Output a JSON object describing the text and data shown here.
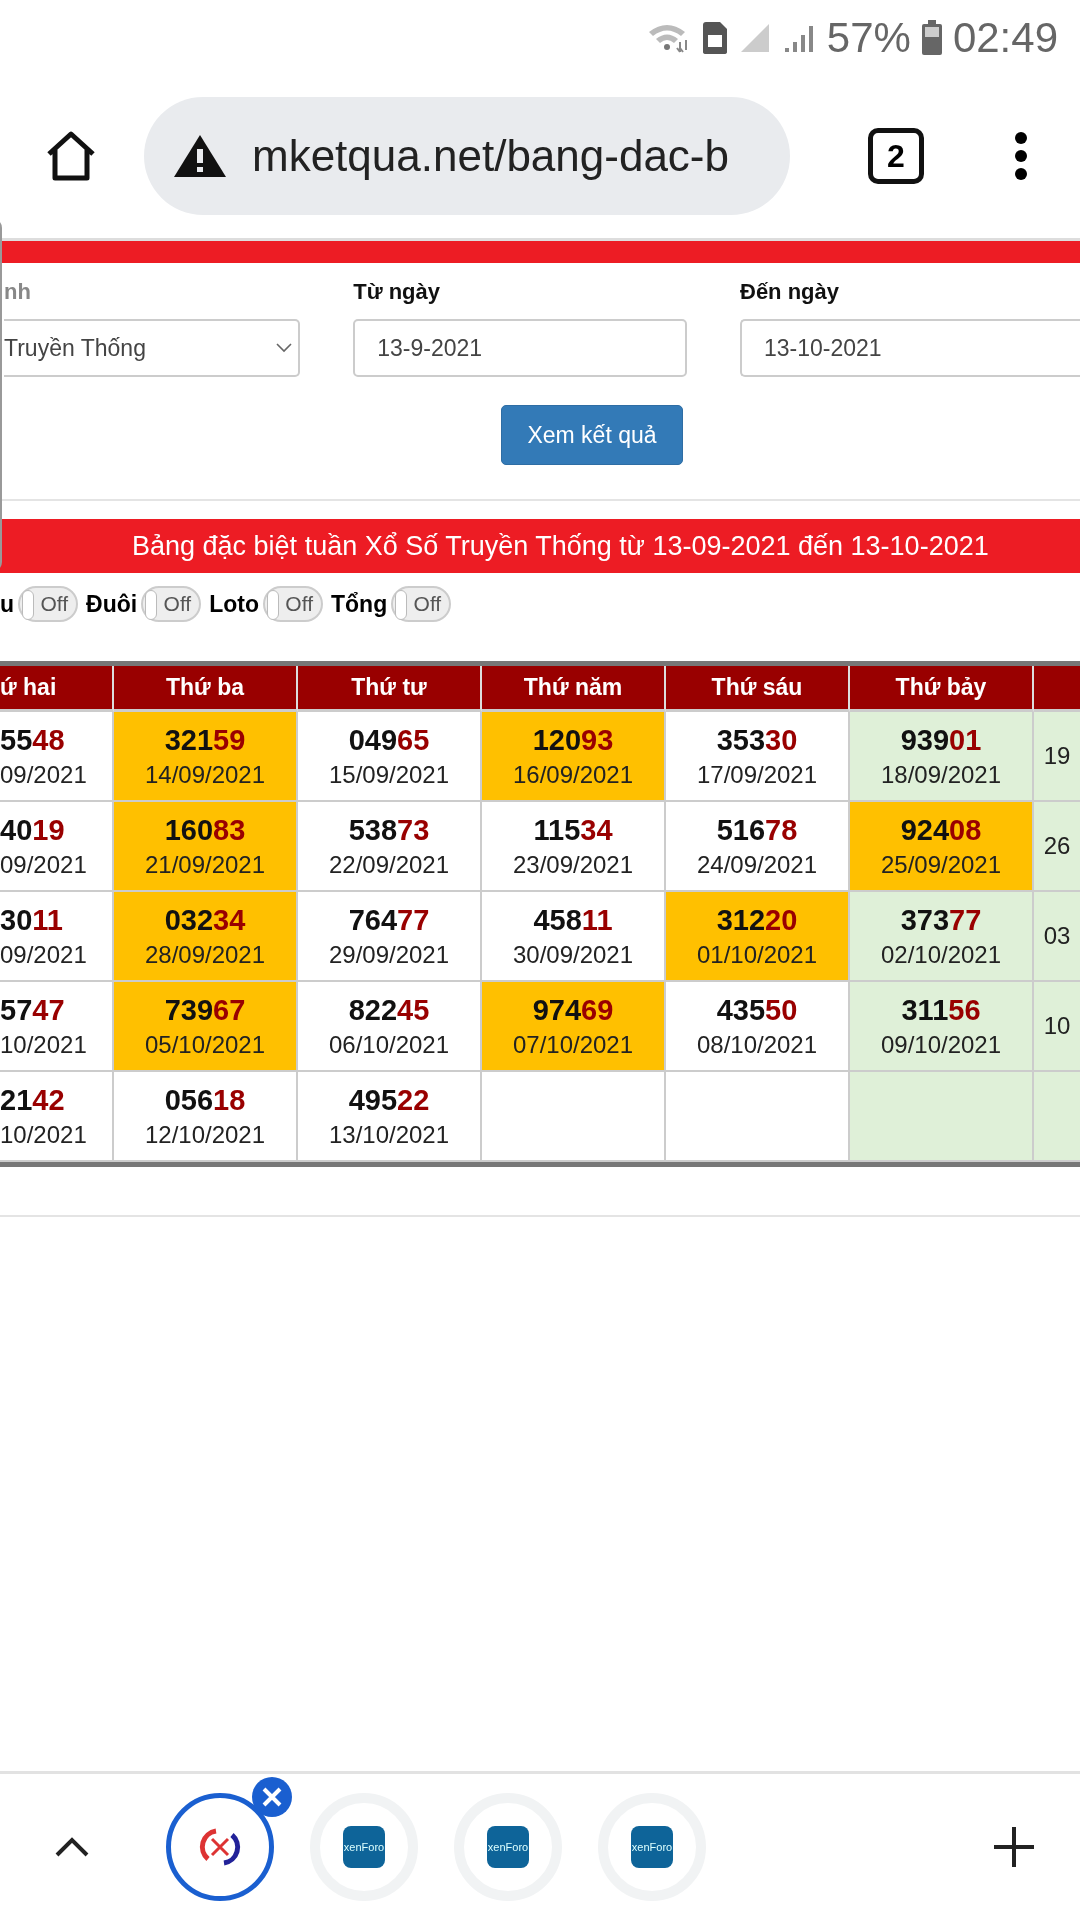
{
  "status_bar": {
    "battery": "57%",
    "time": "02:49"
  },
  "browser": {
    "url": "mketqua.net/bang-dac-b",
    "tab_count": "2"
  },
  "filters": {
    "fields": [
      {
        "label": "nh",
        "kind": "select",
        "value": "Truyền Thống"
      },
      {
        "label": "Từ ngày",
        "kind": "input",
        "value": "13-9-2021"
      },
      {
        "label": "Đến ngày",
        "kind": "input",
        "value": "13-10-2021"
      }
    ],
    "button": "Xem kết quả"
  },
  "table_title": "Bảng đặc biệt tuần Xổ Số Truyền Thống từ 13-09-2021 đến 13-10-2021",
  "toggles": [
    {
      "label": "u",
      "text": "Off",
      "on": false
    },
    {
      "label": "Đuôi",
      "text": "Off",
      "on": false
    },
    {
      "label": "Loto",
      "text": "Off",
      "on": false
    },
    {
      "label": "Tổng",
      "text": "Off",
      "on": false
    }
  ],
  "table": {
    "columns": [
      "ứ hai",
      "Thứ ba",
      "Thứ tư",
      "Thứ năm",
      "Thứ sáu",
      "Thứ bảy"
    ],
    "rows": [
      {
        "cells": [
          {
            "number": "5548",
            "date": "09/2021",
            "color": "#ffffff"
          },
          {
            "number": "32159",
            "date": "14/09/2021",
            "color": "#ffc000"
          },
          {
            "number": "04965",
            "date": "15/09/2021",
            "color": "#ffffff"
          },
          {
            "number": "12093",
            "date": "16/09/2021",
            "color": "#ffc000"
          },
          {
            "number": "35330",
            "date": "17/09/2021",
            "color": "#ffffff"
          },
          {
            "number": "93901",
            "date": "18/09/2021",
            "color": "#dff0d8"
          },
          {
            "date": "19",
            "color": "#dff0d8"
          }
        ]
      },
      {
        "cells": [
          {
            "number": "4019",
            "date": "09/2021",
            "color": "#ffffff"
          },
          {
            "number": "16083",
            "date": "21/09/2021",
            "color": "#ffc000"
          },
          {
            "number": "53873",
            "date": "22/09/2021",
            "color": "#ffffff"
          },
          {
            "number": "11534",
            "date": "23/09/2021",
            "color": "#ffffff"
          },
          {
            "number": "51678",
            "date": "24/09/2021",
            "color": "#ffffff"
          },
          {
            "number": "92408",
            "date": "25/09/2021",
            "color": "#ffc000"
          },
          {
            "date": "26",
            "color": "#dff0d8"
          }
        ]
      },
      {
        "cells": [
          {
            "number": "3011",
            "date": "09/2021",
            "color": "#ffffff"
          },
          {
            "number": "03234",
            "date": "28/09/2021",
            "color": "#ffc000"
          },
          {
            "number": "76477",
            "date": "29/09/2021",
            "color": "#ffffff"
          },
          {
            "number": "45811",
            "date": "30/09/2021",
            "color": "#ffffff"
          },
          {
            "number": "31220",
            "date": "01/10/2021",
            "color": "#ffc000"
          },
          {
            "number": "37377",
            "date": "02/10/2021",
            "color": "#dff0d8"
          },
          {
            "date": "03",
            "color": "#dff0d8"
          }
        ]
      },
      {
        "cells": [
          {
            "number": "5747",
            "date": "10/2021",
            "color": "#ffffff"
          },
          {
            "number": "73967",
            "date": "05/10/2021",
            "color": "#ffc000"
          },
          {
            "number": "82245",
            "date": "06/10/2021",
            "color": "#ffffff"
          },
          {
            "number": "97469",
            "date": "07/10/2021",
            "color": "#ffc000"
          },
          {
            "number": "43550",
            "date": "08/10/2021",
            "color": "#ffffff"
          },
          {
            "number": "31156",
            "date": "09/10/2021",
            "color": "#dff0d8"
          },
          {
            "date": "10",
            "color": "#dff0d8"
          }
        ]
      },
      {
        "cells": [
          {
            "number": "2142",
            "date": "10/2021",
            "color": "#ffffff"
          },
          {
            "number": "05618",
            "date": "12/10/2021",
            "color": "#ffffff"
          },
          {
            "number": "49522",
            "date": "13/10/2021",
            "color": "#ffffff"
          },
          {
            "color": "#ffffff"
          },
          {
            "color": "#ffffff"
          },
          {
            "color": "#dff0d8"
          },
          {
            "color": "#dff0d8"
          }
        ]
      }
    ]
  },
  "bottom_bar": {
    "tabs": [
      {
        "kind": "site",
        "selected": true
      },
      {
        "kind": "xenforo",
        "label": "xenForo",
        "selected": false
      },
      {
        "kind": "xenforo",
        "label": "xenForo",
        "selected": false
      },
      {
        "kind": "xenforo",
        "label": "xenForo",
        "selected": false
      }
    ]
  }
}
